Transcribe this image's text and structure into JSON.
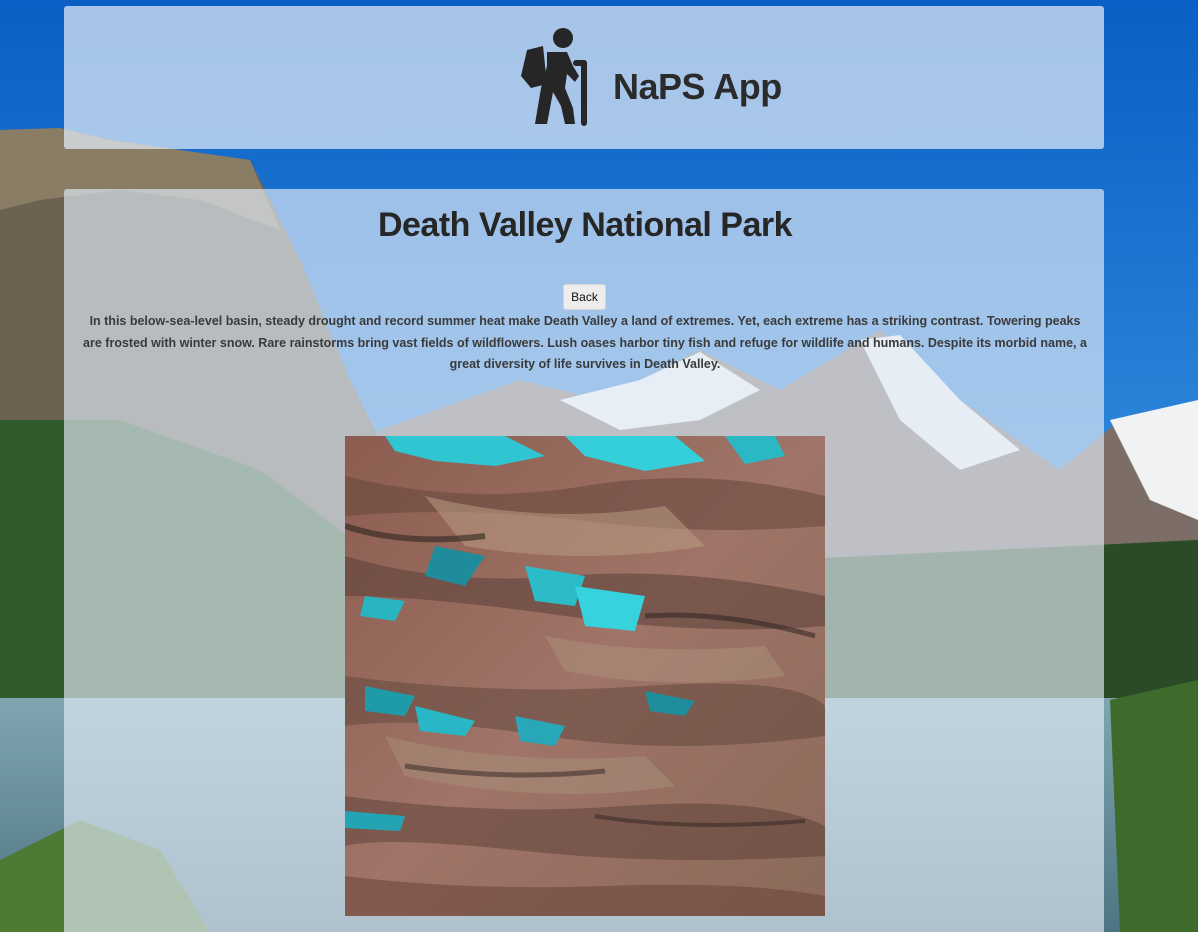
{
  "header": {
    "logo_icon": "hiker-icon",
    "app_title": "NaPS App"
  },
  "park": {
    "name": "Death Valley National Park",
    "back_label": "Back",
    "description": "In this below-sea-level basin, steady drought and record summer heat make Death Valley a land of extremes. Yet, each extreme has a striking contrast. Towering peaks are frosted with winter snow. Rare rainstorms bring vast fields of wildflowers. Lush oases harbor tiny fish and refuge for wildlife and humans. Despite its morbid name, a great diversity of life survives in Death Valley.",
    "image_icon": "satellite-terrain-image"
  },
  "colors": {
    "sky": "#0a62c8",
    "panel": "#e2ecf6",
    "text": "#2b2b2b",
    "terrain_red": "#9a6a5c",
    "terrain_cyan": "#2fd0dc"
  }
}
